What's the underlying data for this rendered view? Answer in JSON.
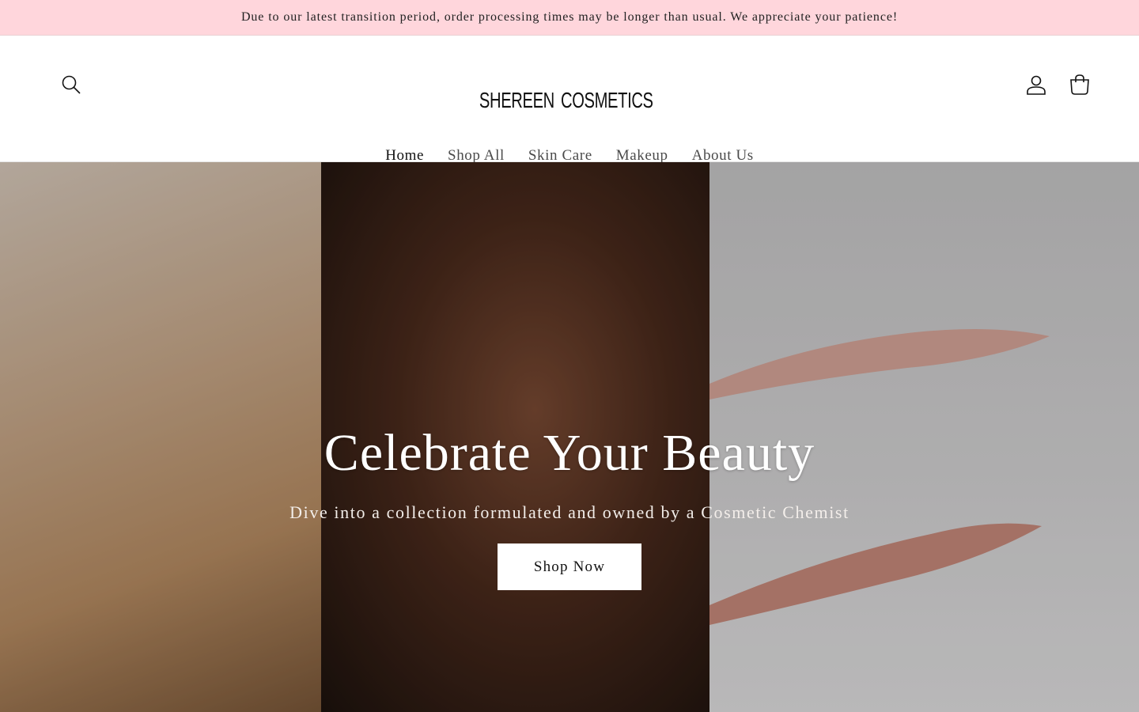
{
  "announcement": "Due to our latest transition period, order processing times may be longer than usual. We appreciate your patience!",
  "header": {
    "logo_left": "SHEREEN",
    "logo_right": "COSMETICS",
    "icons": {
      "search": "search-icon",
      "account": "account-icon",
      "cart": "cart-icon"
    }
  },
  "nav": {
    "items": [
      {
        "label": "Home",
        "active": true
      },
      {
        "label": "Shop All"
      },
      {
        "label": "Skin Care"
      },
      {
        "label": "Makeup"
      },
      {
        "label": "About Us"
      }
    ]
  },
  "hero": {
    "title": "Celebrate Your Beauty",
    "subtitle": "Dive into a collection formulated and owned by a Cosmetic Chemist",
    "button": "Shop Now"
  },
  "colors": {
    "announcement_bg": "#ffd6dc",
    "button_bg": "#ffffff",
    "text": "#121212"
  }
}
